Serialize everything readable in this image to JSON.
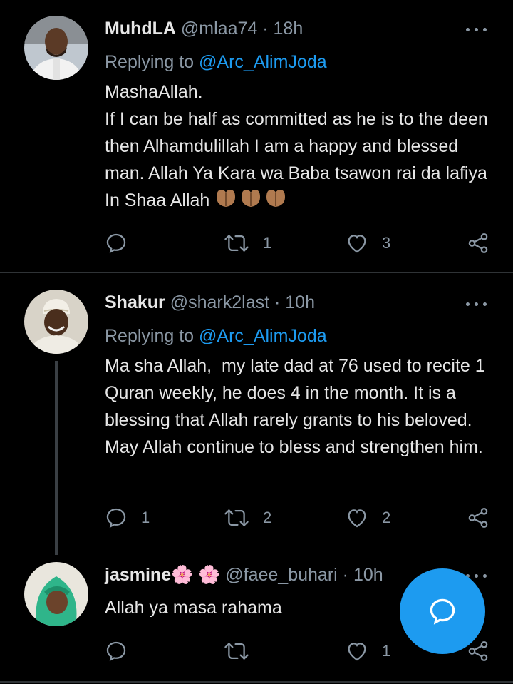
{
  "tweets": [
    {
      "name": "MuhdLA",
      "handle": "@mlaa74",
      "dot": "·",
      "time": "18h",
      "reply_prefix": "Replying to ",
      "reply_mention": "@Arc_AlimJoda",
      "body_lines": [
        "MashaAllah.",
        "If I can be half as committed as he is to the deen then Alhamdulillah I am a happy and blessed man. Allah Ya Kara wa Baba tsawon rai da lafiya In Shaa Allah"
      ],
      "emoji_count": 3,
      "reply_count": "",
      "retweet_count": "1",
      "like_count": "3"
    },
    {
      "name": "Shakur",
      "handle": "@shark2last",
      "dot": "·",
      "time": "10h",
      "reply_prefix": "Replying to ",
      "reply_mention": "@Arc_AlimJoda",
      "body": "Ma sha Allah,  my late dad at 76 used to recite 1 Quran weekly, he does 4 in the month. It is a blessing that Allah rarely grants to his beloved. May Allah continue to bless and strengthen him.",
      "reply_count": "1",
      "retweet_count": "2",
      "like_count": "2"
    },
    {
      "name": "jasmine",
      "name_flowers": "🌸 🌸",
      "handle": "@faee_buhari",
      "dot": "·",
      "time": "10h",
      "body": "Allah ya masa rahama",
      "reply_count": "",
      "retweet_count": "",
      "like_count": "1"
    }
  ],
  "icons": {
    "reply": "reply-icon",
    "retweet": "retweet-icon",
    "like": "heart-icon",
    "share": "share-icon",
    "more": "more-dots-icon",
    "compose": "compose-reply-icon"
  },
  "colors": {
    "background": "#000000",
    "accent": "#1d9bf0",
    "muted": "#8b98a5",
    "text": "#e6e6e6"
  }
}
